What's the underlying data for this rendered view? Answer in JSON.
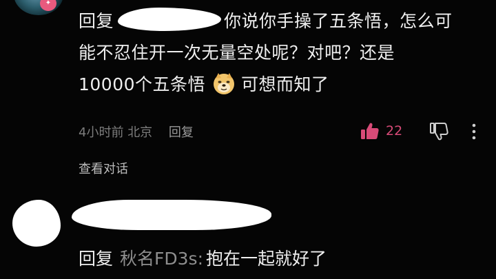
{
  "comment": {
    "reply_prefix": "回复",
    "text_line1": "你说你手操了五条悟，怎么可",
    "text_line2": "能不忍住开一次无量空处呢？对吧？还是",
    "text_line3a": "10000个五条悟",
    "text_line3b": "可想而知了",
    "emoji": "doge-emoji",
    "time": "4小时前",
    "location": "北京",
    "reply_button": "回复",
    "like_count": "22",
    "view_conversation": "查看对话"
  },
  "reply_comment": {
    "reply_prefix": "回复",
    "mention": "秋名FD3s:",
    "text": "抱在一起就好了"
  },
  "colors": {
    "background": "#050505",
    "text": "#efefef",
    "meta": "#7d7d7d",
    "like_accent": "#d84b78",
    "badge": "#e85a7e"
  }
}
